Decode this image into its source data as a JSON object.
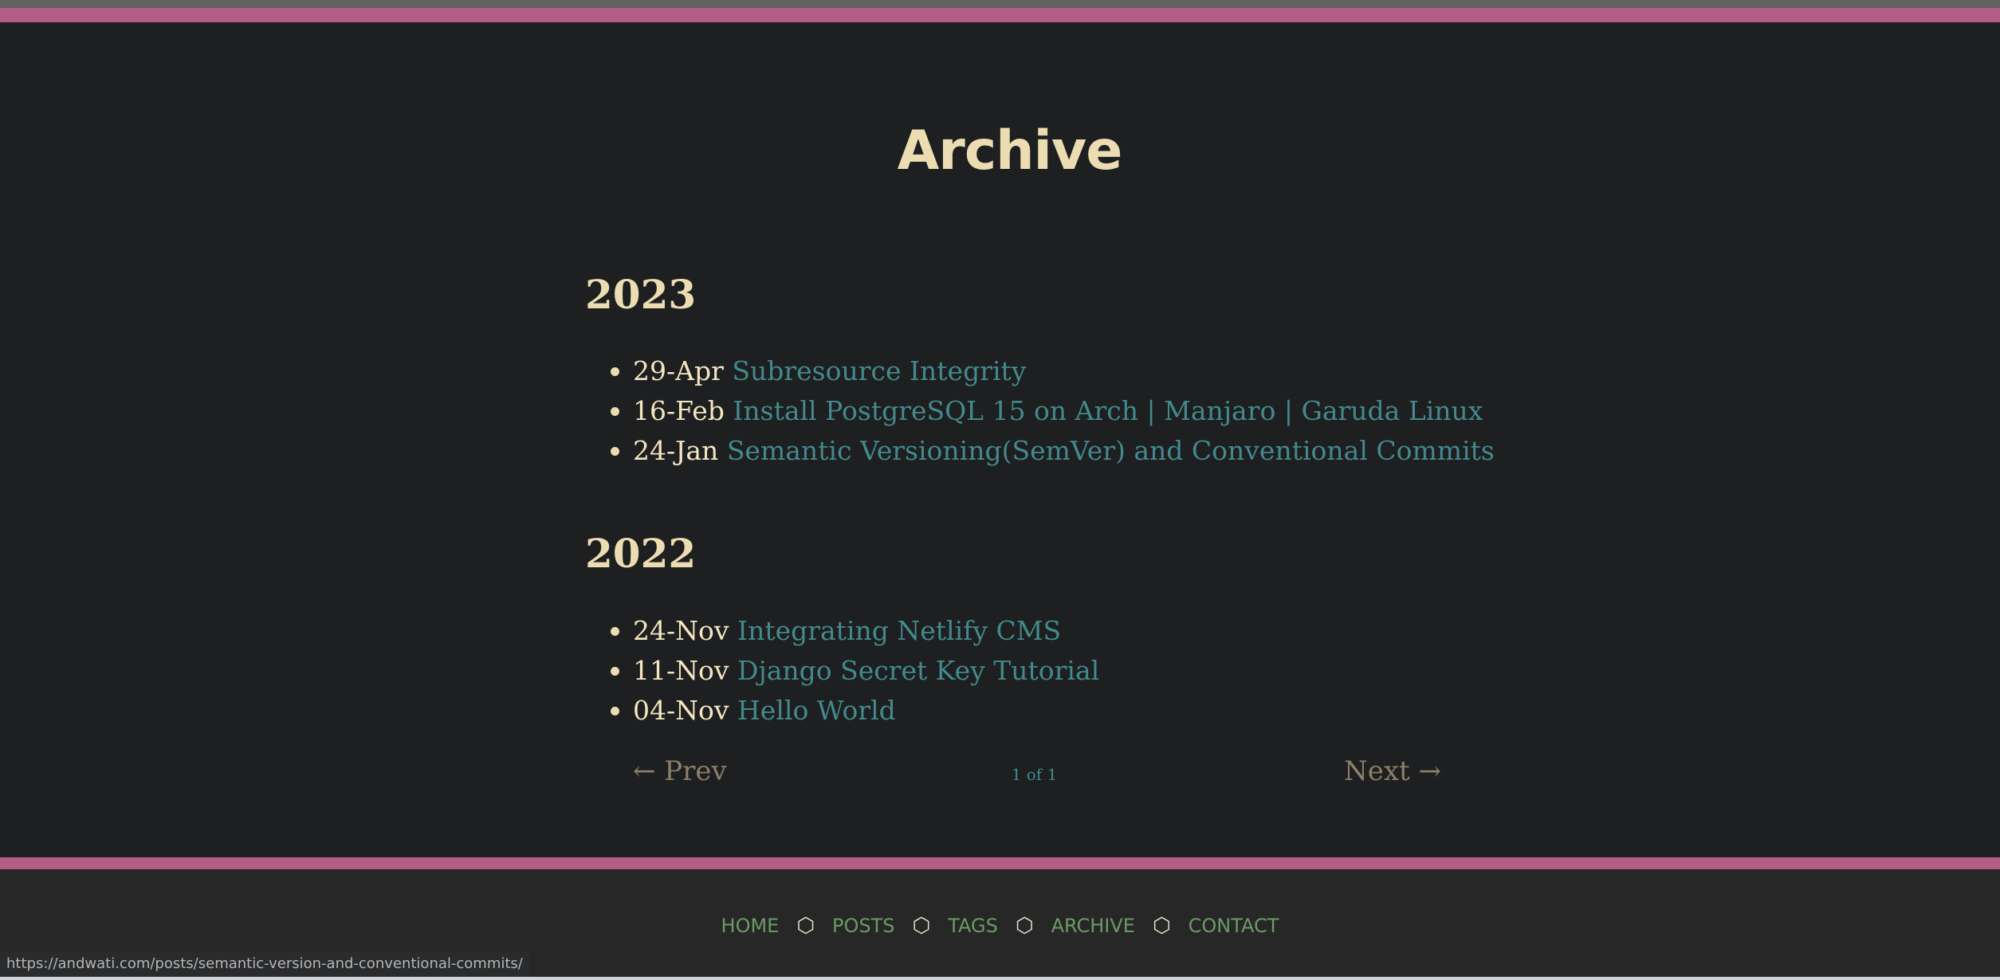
{
  "page": {
    "title": "Archive"
  },
  "archive": {
    "years": [
      {
        "year": "2023",
        "posts": [
          {
            "date": "29-Apr",
            "title": "Subresource Integrity"
          },
          {
            "date": "16-Feb",
            "title": "Install PostgreSQL 15 on Arch | Manjaro | Garuda Linux"
          },
          {
            "date": "24-Jan",
            "title": "Semantic Versioning(SemVer) and Conventional Commits"
          }
        ]
      },
      {
        "year": "2022",
        "posts": [
          {
            "date": "24-Nov",
            "title": "Integrating Netlify CMS"
          },
          {
            "date": "11-Nov",
            "title": "Django Secret Key Tutorial"
          },
          {
            "date": "04-Nov",
            "title": "Hello World"
          }
        ]
      }
    ]
  },
  "pagination": {
    "prev": "← Prev",
    "count": "1 of 1",
    "next": "Next →"
  },
  "footer": {
    "nav": [
      "HOME",
      "POSTS",
      "TAGS",
      "ARCHIVE",
      "CONTACT"
    ],
    "separator": "⬡"
  },
  "status_bar": {
    "url": "https://andwati.com/posts/semantic-version-and-conventional-commits/"
  },
  "colors": {
    "background": "#1d1f20",
    "accent_stripe": "#b45d87",
    "heading": "#ecdcb2",
    "link": "#43898d",
    "footer_link": "#6b9a66",
    "pager": "#8d7f69"
  }
}
